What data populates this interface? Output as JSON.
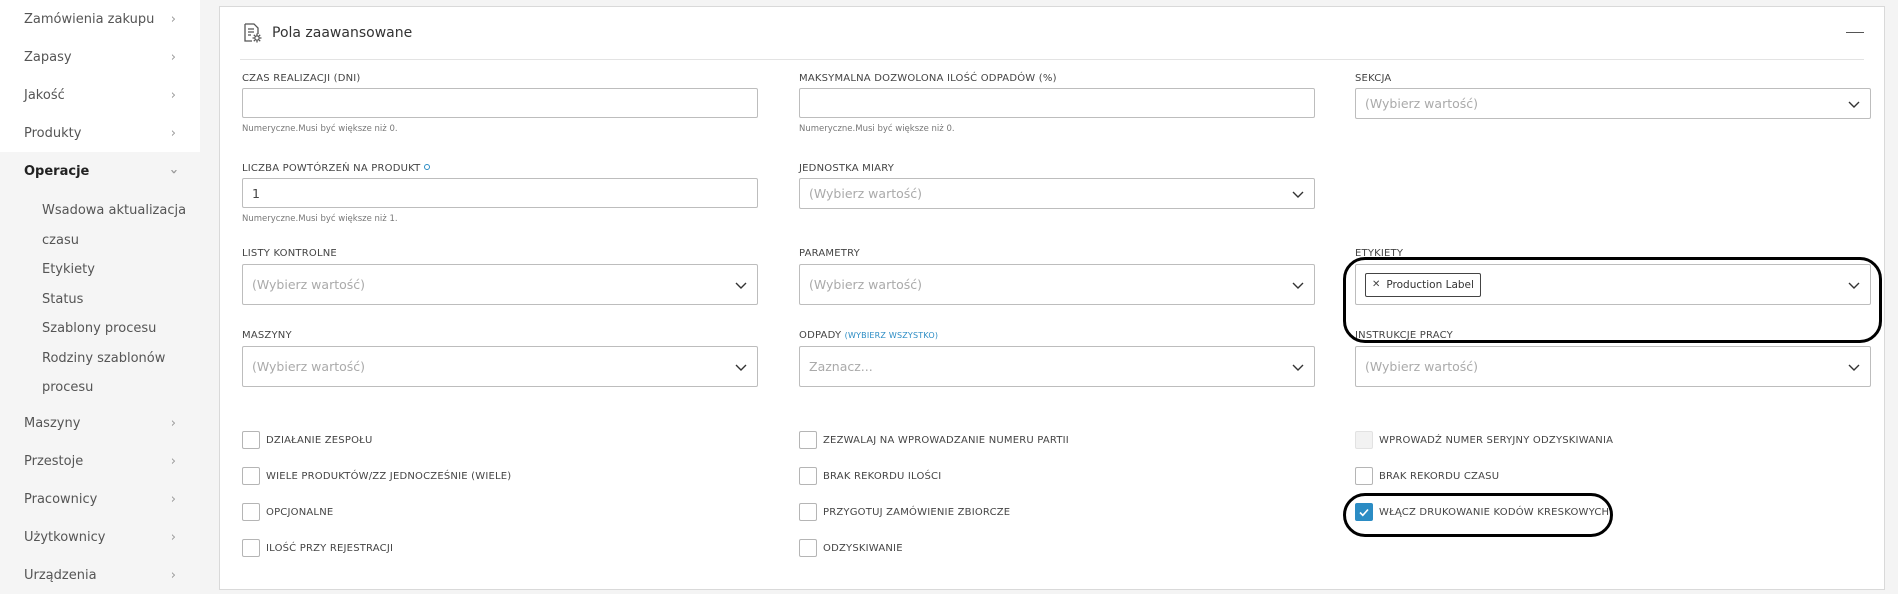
{
  "sidebar": {
    "items_top": [
      {
        "label": "Zamówienia zakupu"
      },
      {
        "label": "Zapasy"
      },
      {
        "label": "Jakość"
      },
      {
        "label": "Produkty"
      }
    ],
    "active": {
      "label": "Operacje"
    },
    "sub_items": [
      {
        "label": "Wsadowa aktualizacja"
      },
      {
        "label": "czasu"
      },
      {
        "label": "Etykiety"
      },
      {
        "label": "Status"
      },
      {
        "label": "Szablony procesu"
      },
      {
        "label": "Rodziny szablonów"
      },
      {
        "label": "procesu"
      }
    ],
    "items_bottom": [
      {
        "label": "Maszyny"
      },
      {
        "label": "Przestoje"
      },
      {
        "label": "Pracownicy"
      },
      {
        "label": "Użytkownicy"
      },
      {
        "label": "Urządzenia"
      }
    ]
  },
  "panel": {
    "title": "Pola zaawansowane"
  },
  "fields": {
    "lead_time": {
      "label": "CZAS REALIZACJI (DNI)",
      "value": "",
      "hint": "Numeryczne.Musi być większe niż 0."
    },
    "max_scrap": {
      "label": "MAKSYMALNA DOZWOLONA ILOŚĆ ODPADÓW (%)",
      "value": "",
      "hint": "Numeryczne.Musi być większe niż 0."
    },
    "section": {
      "label": "SEKCJA",
      "placeholder": "(Wybierz wartość)"
    },
    "repetitions": {
      "label": "LICZBA POWTÓRZEŃ NA PRODUKT",
      "value": "1",
      "hint": "Numeryczne.Musi być większe niż 1."
    },
    "unit": {
      "label": "JEDNOSTKA MIARY",
      "placeholder": "(Wybierz wartość)"
    },
    "checklists": {
      "label": "LISTY KONTROLNE",
      "placeholder": "(Wybierz wartość)"
    },
    "parameters": {
      "label": "PARAMETRY",
      "placeholder": "(Wybierz wartość)"
    },
    "labels": {
      "label": "ETYKIETY",
      "chip": "Production Label"
    },
    "machines": {
      "label": "MASZYNY",
      "placeholder": "(Wybierz wartość)"
    },
    "scrap": {
      "label": "ODPADY",
      "link": "(WYBIERZ WSZYSTKO)",
      "placeholder": "Zaznacz..."
    },
    "work_instructions": {
      "label": "INSTRUKCJE PRACY",
      "placeholder": "(Wybierz wartość)"
    }
  },
  "checkboxes": {
    "col1": [
      {
        "label": "DZIAŁANIE ZESPOŁU",
        "checked": false
      },
      {
        "label": "WIELE PRODUKTÓW/ZZ JEDNOCZEŚNIE (WIELE)",
        "checked": false
      },
      {
        "label": "OPCJONALNE",
        "checked": false
      },
      {
        "label": "ILOŚĆ PRZY REJESTRACJI",
        "checked": false
      }
    ],
    "col2": [
      {
        "label": "ZEZWALAJ NA WPROWADZANIE NUMERU PARTII",
        "checked": false
      },
      {
        "label": "BRAK REKORDU ILOŚCI",
        "checked": false
      },
      {
        "label": "PRZYGOTUJ ZAMÓWIENIE ZBIORCZE",
        "checked": false
      },
      {
        "label": "ODZYSKIWANIE",
        "checked": false
      }
    ],
    "col3": [
      {
        "label": "WPROWADŹ NUMER SERYJNY ODZYSKIWANIA",
        "checked": false,
        "disabled": true
      },
      {
        "label": "BRAK REKORDU CZASU",
        "checked": false
      },
      {
        "label": "WŁĄCZ DRUKOWANIE KODÓW KRESKOWYCH",
        "checked": true
      }
    ]
  },
  "colors": {
    "accent": "#2b8cc4",
    "highlight": "#000000"
  }
}
